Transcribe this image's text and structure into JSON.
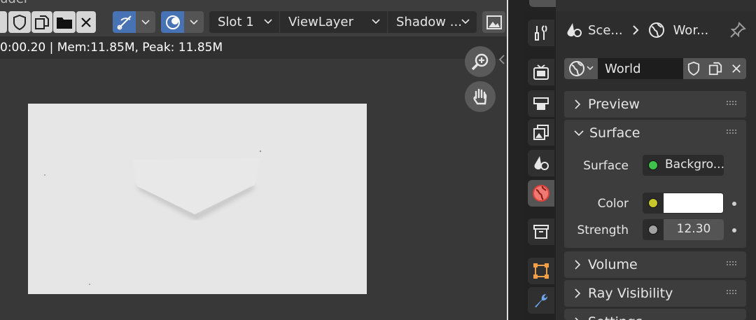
{
  "image_editor": {
    "title_fragment": "uder",
    "stats": "0:00.20 | Mem:11.85M, Peak: 11.85M",
    "slot": "Slot 1",
    "view_layer": "ViewLayer",
    "pass": "Shadow ..."
  },
  "properties": {
    "breadcrumb": {
      "scene": "Sce...",
      "world": "Wor..."
    },
    "datablock": {
      "name": "World"
    },
    "panels": {
      "preview": "Preview",
      "surface": "Surface",
      "volume": "Volume",
      "ray_visibility": "Ray Visibility",
      "settings": "Settings"
    },
    "surface": {
      "surface_label": "Surface",
      "surface_value": "Backgro...",
      "color_label": "Color",
      "color_value": "#ffffff",
      "strength_label": "Strength",
      "strength_value": "12.30"
    }
  },
  "colors": {
    "accent_blue": "#4772b3",
    "active_tab_world_red": "#d9534f",
    "socket_shader_green": "#3ec24a",
    "socket_color_yellow": "#c7c729",
    "socket_value_gray": "#a1a1a1"
  }
}
